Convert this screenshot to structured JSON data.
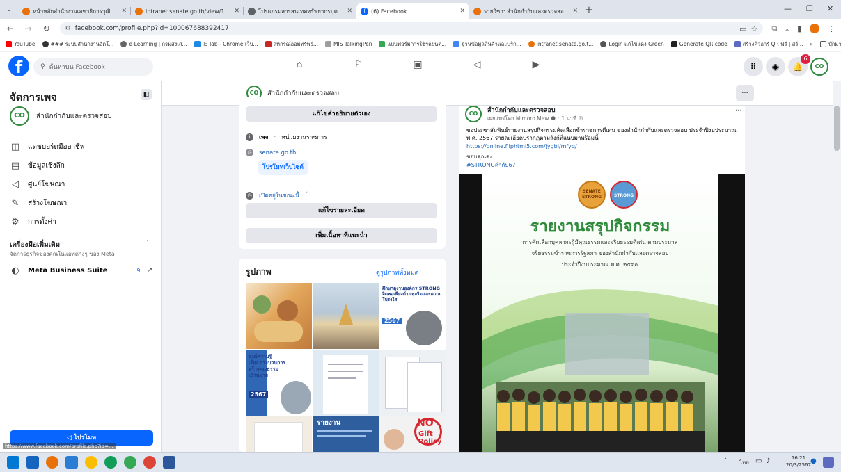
{
  "browser": {
    "tabs": [
      {
        "title": "หน้าหลักสำนักงานเลขาธิการวุฒิสภา",
        "active": false
      },
      {
        "title": "intranet.senate.go.th/view/1/...",
        "active": false
      },
      {
        "title": "โปรแกรมสารสนเทศทรัพยากรบุคคล",
        "active": false
      },
      {
        "title": "(6) Facebook",
        "active": true
      },
      {
        "title": "รายวิชา: สำนักกำกับและตรวจสอบ 2...",
        "active": false
      }
    ],
    "new_tab": "+",
    "url": "facebook.com/profile.php?id=100067688392417",
    "bookmarks": [
      "YouTube",
      "### ระบบสำนักงานอัตโ...",
      "e-Learning | กรมส่งเส...",
      "IE Tab - Chrome เว็บ...",
      "สหกรณ์ออมทรัพย์...",
      "MIS TalkingPen",
      "แบบฟอร์มการใช้รถยนต...",
      "ฐานข้อมูลสินค้าและบริก...",
      "intranet.senate.go.t...",
      "Login แก้ไขแดง Green",
      "Generate QR code",
      "สร้างคิวอาร์ QR ฟรี | สร้...",
      "บุ๊กมาร์กอื่นๆ"
    ],
    "more_bookmarks": "»"
  },
  "fb": {
    "search_placeholder": "ค้นหาบน Facebook",
    "notifications_count": "6"
  },
  "sidebar": {
    "title": "จัดการเพจ",
    "page_name": "สำนักกำกับและตรวจสอบ",
    "items": [
      {
        "label": "แดชบอร์ดมืออาชีพ",
        "icon": "dashboard-icon"
      },
      {
        "label": "ข้อมูลเชิงลึก",
        "icon": "insights-icon"
      },
      {
        "label": "ศูนย์โฆษณา",
        "icon": "megaphone-icon"
      },
      {
        "label": "สร้างโฆษณา",
        "icon": "pencil-icon"
      },
      {
        "label": "การตั้งค่า",
        "icon": "gear-icon"
      }
    ],
    "tools_title": "เครื่องมือเพิ่มเติม",
    "tools_subtitle": "จัดการธุรกิจของคุณในแอพต่างๆ ของ Meta",
    "meta_suite": "Meta Business Suite",
    "meta_suite_count": "9",
    "promote": "โปรโมท",
    "status_url": "https://www.facebook.com/profile.php?id=..."
  },
  "pagebar": {
    "name": "สำนักกำกับและตรวจสอบ",
    "more": "..."
  },
  "intro": {
    "edit_bio": "แก้ไขคำอธิบายตัวเอง",
    "category_prefix": "เพจ",
    "category": "หน่วยงานราชการ",
    "website": "senate.go.th",
    "promote_site": "โปรโมทเว็บไซต์",
    "open_now": "เปิดอยู่ในขณะนี้",
    "edit_details": "แก้ไขรายละเอียด",
    "add_featured": "เพิ่มเนื้อหาที่แนะนำ"
  },
  "photos": {
    "title": "รูปภาพ",
    "see_all": "ดูรูปภาพทั้งหมด",
    "tiles": [
      {
        "texts": [],
        "bg": "#e9d9b8"
      },
      {
        "texts": [],
        "bg": "#c9d8e3"
      },
      {
        "texts": [
          "ศึกษาดูงานองค์กร STRONG",
          "จิตพอเพียงต้านทุจริตและความโปร่งใส",
          "2567"
        ],
        "bg": "#ffffff"
      },
      {
        "texts": [
          "องค์ความรู้",
          "เรื่อง กระบวนการ",
          "สร้างคุณธรรม",
          "เป้าหมาย",
          "2567"
        ],
        "bg": "#ffffff"
      },
      {
        "texts": [],
        "bg": "#dfeaf3"
      },
      {
        "texts": [],
        "bg": "#eef1f4"
      },
      {
        "texts": [],
        "bg": "#f3ece3"
      },
      {
        "texts": [
          "รายงาน"
        ],
        "bg": "#2f5e9e"
      },
      {
        "texts": [
          "NO",
          "Gift",
          "Policy"
        ],
        "bg": "#f2f2f2"
      }
    ]
  },
  "post": {
    "author": "สำนักกำกับและตรวจสอบ",
    "meta": "เผยแพร่โดย Mimoro Mew",
    "time": "1 นาที",
    "body": "ขอประชาสัมพันธ์รายงานสรุปกิจกรรมคัดเลือกข้าราชการดีเด่น ของสำนักกำกับและตรวจสอบ ประจำปีงบประมาณ พ.ศ. 2567 รายละเอียดปรากฏตามลิงก์ที่แนบมาพร้อมนี้",
    "link": "https://online.fliphtml5.com/jygbl/mfyq/",
    "thanks": "ขอบคุณค่ะ",
    "hashtag": "#STRONGคำกับ67",
    "more": "···"
  },
  "poster": {
    "logo1": "SENATE STRONG",
    "logo2": "STRONG",
    "title": "รายงานสรุปกิจกรรม",
    "line1": "การคัดเลือกบุคลากรผู้มีคุณธรรมและจริยธรรมดีเด่น ตามประมวล",
    "line2": "จริยธรรมข้าราชการรัฐสภา ของสำนักกำกับและตรวจสอบ",
    "line3": "ประจำปีงบประมาณ พ.ศ. ๒๕๖๗"
  },
  "taskbar": {
    "lang": "ไทย",
    "time": "16:21",
    "date": "20/3/2567"
  },
  "colors": {
    "fb_blue": "#0866ff",
    "page_green": "#2d8a3e",
    "poster_title": "#2e8b3a"
  }
}
